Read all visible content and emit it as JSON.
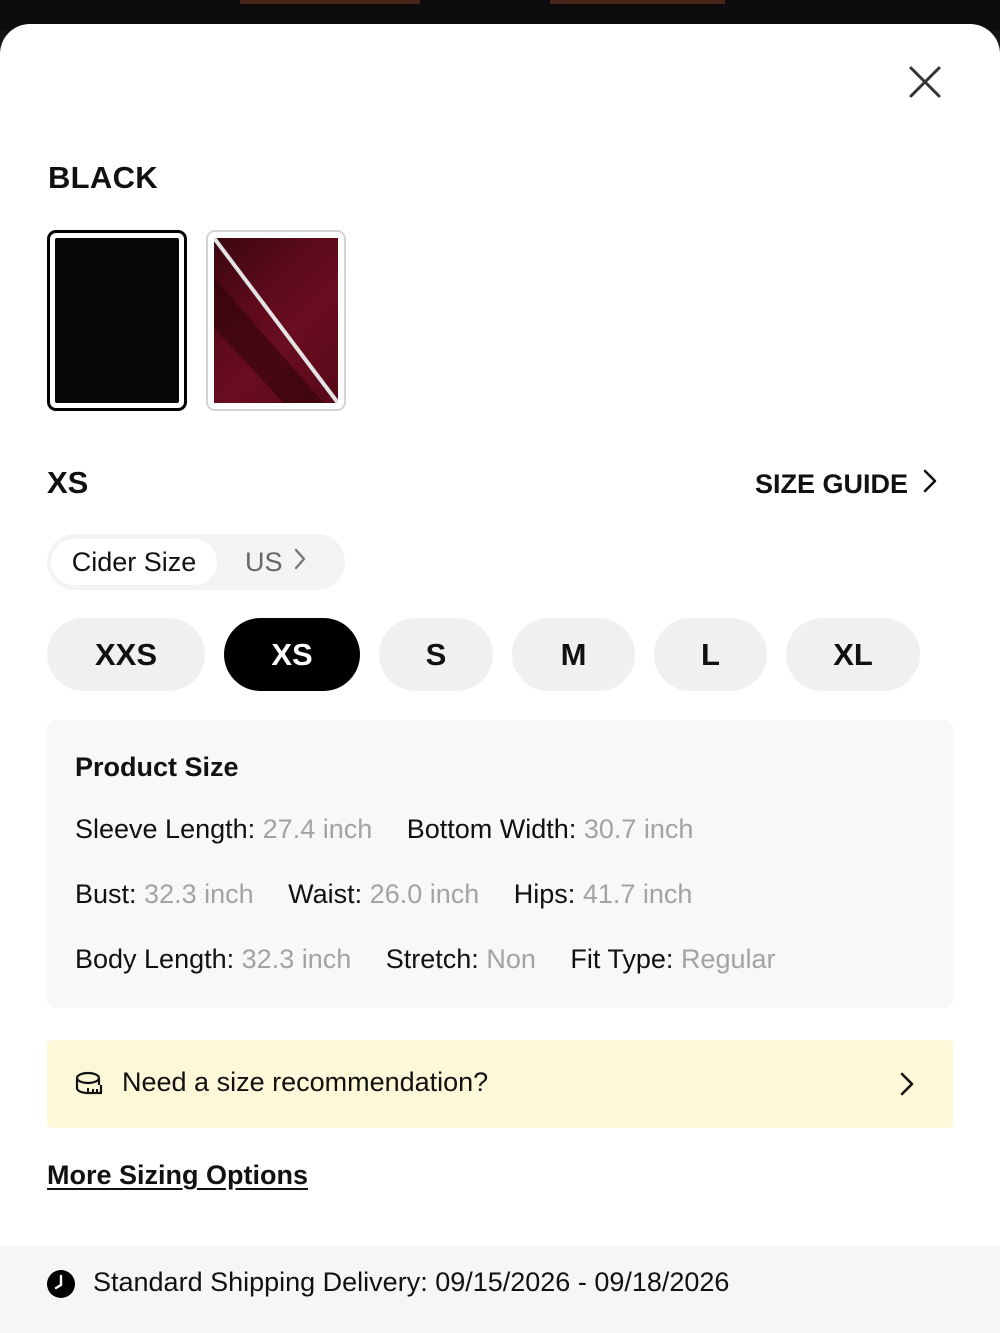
{
  "color": {
    "selected_name": "BLACK",
    "swatches": [
      {
        "name": "Black",
        "hex": "#060606",
        "selected": true,
        "available": true
      },
      {
        "name": "Wine Red",
        "hex": "#5b0a1b",
        "selected": false,
        "available": false
      }
    ]
  },
  "size": {
    "selected_label": "XS",
    "guide_label": "SIZE GUIDE",
    "systems": {
      "active": "Cider Size",
      "other": "US"
    },
    "options": [
      "XXS",
      "XS",
      "S",
      "M",
      "L",
      "XL"
    ]
  },
  "product_size": {
    "title": "Product Size",
    "rows": [
      [
        {
          "label": "Sleeve Length:",
          "value": "27.4 inch"
        },
        {
          "label": "Bottom Width:",
          "value": "30.7 inch"
        }
      ],
      [
        {
          "label": "Bust:",
          "value": "32.3 inch"
        },
        {
          "label": "Waist:",
          "value": "26.0 inch"
        },
        {
          "label": "Hips:",
          "value": "41.7 inch"
        }
      ],
      [
        {
          "label": "Body Length:",
          "value": "32.3 inch"
        },
        {
          "label": "Stretch:",
          "value": "Non"
        },
        {
          "label": "Fit Type:",
          "value": "Regular"
        }
      ]
    ]
  },
  "recommendation": {
    "text": "Need a size recommendation?"
  },
  "more_sizing_label": "More Sizing Options",
  "shipping": {
    "text": "Standard Shipping Delivery: 09/15/2026 - 09/18/2026"
  },
  "colors": {
    "selected_size_bg": "#000000",
    "size_chip_bg": "#f0f0f0",
    "banner_bg": "#fdf8d8",
    "muted_value": "#a3a3a3"
  }
}
